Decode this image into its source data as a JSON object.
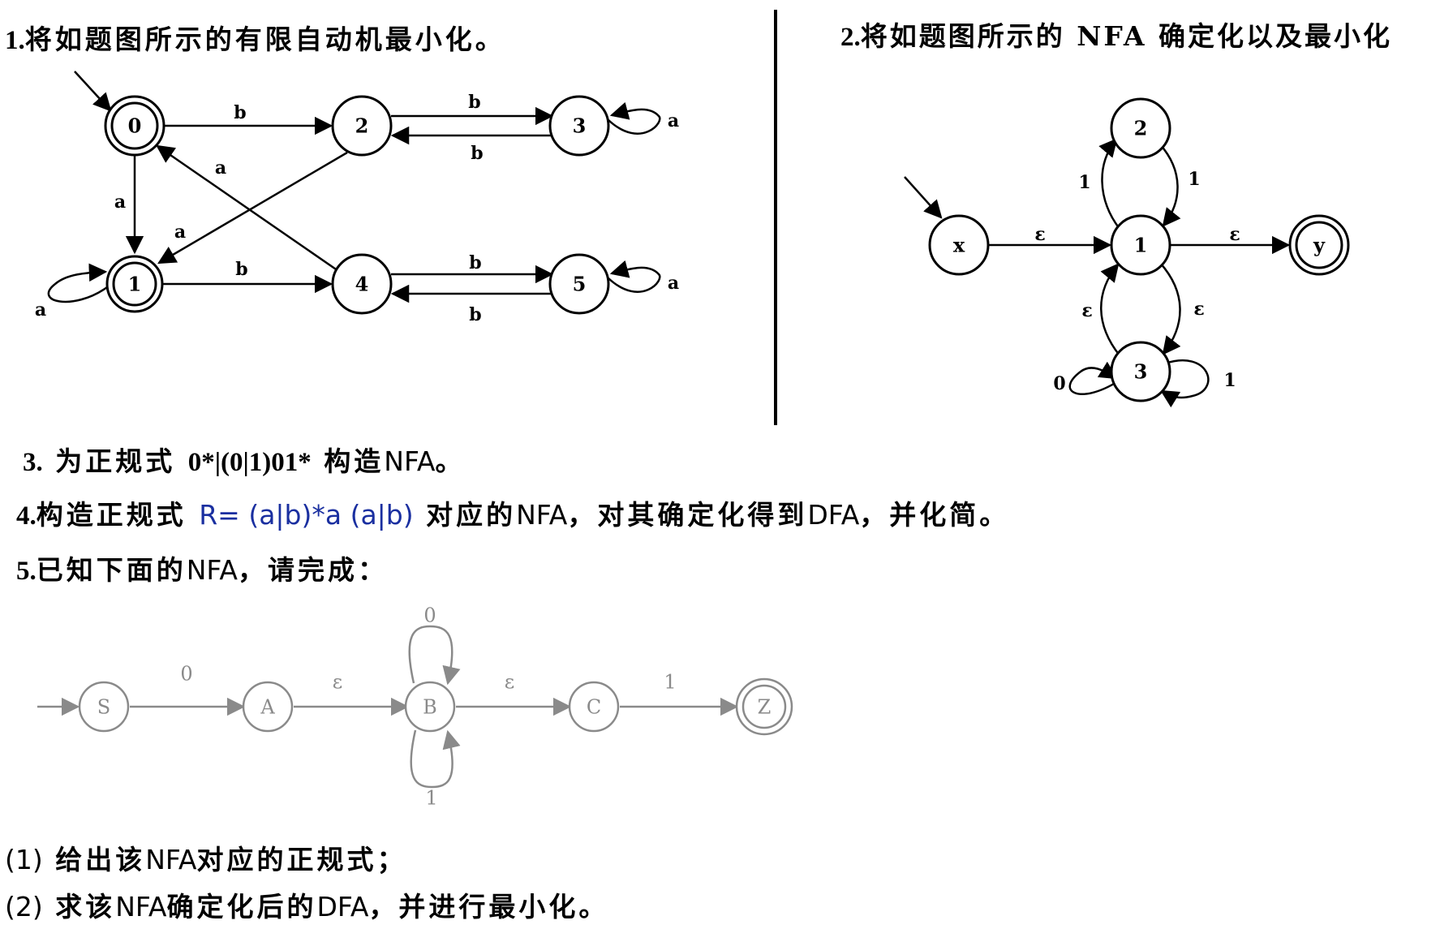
{
  "q1": {
    "num": "1.",
    "text": "将如题图所示的有限自动机最小化。"
  },
  "q2": {
    "num": "2.",
    "text": "将如题图所示的",
    "nfa": "NFA",
    "text2": "确定化以及最小化"
  },
  "q3": {
    "num": "3.",
    "text": "为正规式",
    "regex": "0*|(0|1)01*",
    "text2": "构造",
    "nfa": "NFA",
    "end": "。"
  },
  "q4": {
    "num": "4.",
    "text": "构造正规式",
    "regex": "R= (a|b)*a (a|b)",
    "text2": "对应的",
    "nfa": "NFA",
    "text3": "，对其确定化得到",
    "dfa": "DFA",
    "text4": "，并化简。"
  },
  "q5": {
    "num": "5.",
    "text": "已知下面的",
    "nfa": "NFA",
    "text2": "，请完成："
  },
  "sub1": {
    "num": "(1)",
    "text": "给出该",
    "nfa": "NFA",
    "text2": "对应的正规式；"
  },
  "sub2": {
    "num": "(2)",
    "text": "求该",
    "nfa": "NFA",
    "text2": "确定化后的",
    "dfa": "DFA",
    "text3": "，并进行最小化。"
  },
  "diagram1": {
    "states": [
      "0",
      "1",
      "2",
      "3",
      "4",
      "5"
    ],
    "edges": {
      "e02": "b",
      "e23": "b",
      "e32": "b",
      "e33": "a",
      "e01": "a",
      "e40": "a",
      "e21": "a",
      "e11": "a",
      "e14": "b",
      "e45": "b",
      "e54": "b",
      "e55": "a"
    }
  },
  "diagram2": {
    "states": [
      "x",
      "1",
      "2",
      "3",
      "y"
    ],
    "edges": {
      "ex1": "ε",
      "e1y": "ε",
      "e12": "1",
      "e21": "1",
      "e13": "ε",
      "e31": "ε",
      "e33a": "0",
      "e33b": "1"
    }
  },
  "diagram3": {
    "states": [
      "S",
      "A",
      "B",
      "C",
      "Z"
    ],
    "edges": {
      "eSA": "0",
      "eAB": "ε",
      "eBB0": "0",
      "eBB1": "1",
      "eBC": "ε",
      "eCZ": "1"
    }
  }
}
